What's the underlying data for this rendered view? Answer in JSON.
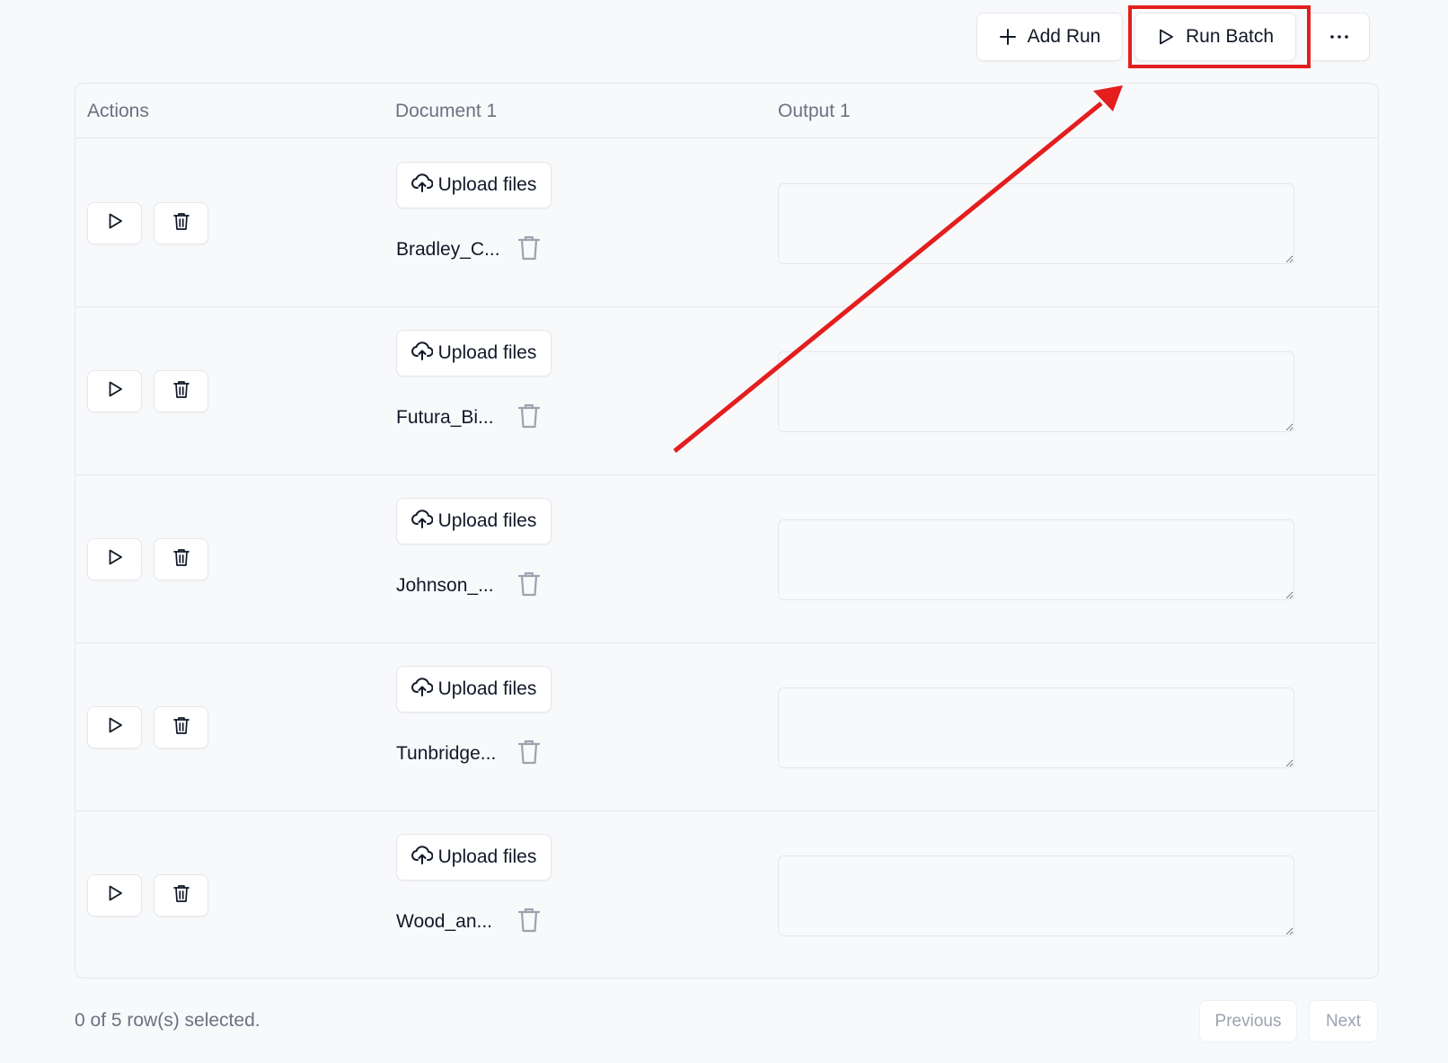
{
  "toolbar": {
    "add_run_label": "Add Run",
    "add_run_icon": "plus-icon",
    "run_batch_label": "Run Batch",
    "run_batch_icon": "play-icon",
    "more_icon": "more-horizontal-icon"
  },
  "table": {
    "columns": [
      "Actions",
      "Document 1",
      "Output 1"
    ],
    "upload_label": "Upload files",
    "rows": [
      {
        "filename": "Bradley_C...",
        "output": ""
      },
      {
        "filename": "Futura_Bi...",
        "output": ""
      },
      {
        "filename": "Johnson_...",
        "output": ""
      },
      {
        "filename": "Tunbridge...",
        "output": ""
      },
      {
        "filename": "Wood_an...",
        "output": ""
      }
    ]
  },
  "footer": {
    "selection_status": "0 of 5 row(s) selected.",
    "previous_label": "Previous",
    "next_label": "Next"
  },
  "annotation": {
    "color": "#e41e1e",
    "target": "run-batch-button"
  }
}
